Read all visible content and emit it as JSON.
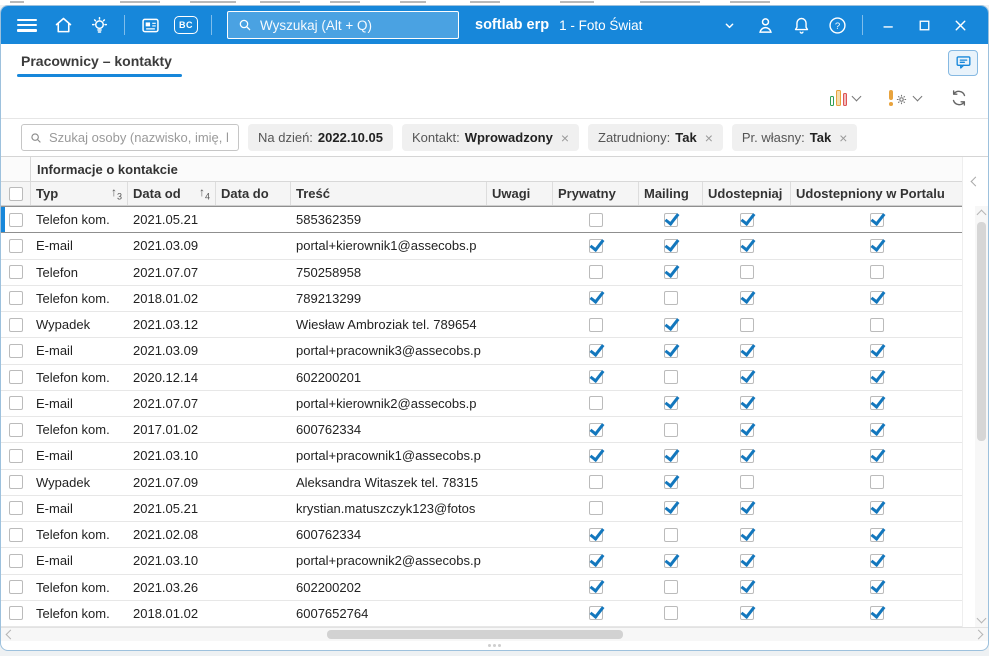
{
  "topbar": {
    "search_placeholder": "Wyszukaj (Alt + Q)",
    "app_name": "softlab erp",
    "company_selector": "1 - Foto Świat",
    "bc_badge": "BC"
  },
  "page": {
    "title": "Pracownicy – kontakty"
  },
  "filters": {
    "person_search_placeholder": "Szukaj osoby (nazwisko, imię, l",
    "chips": [
      {
        "label": "Na dzień:",
        "value": "2022.10.05",
        "closable": false
      },
      {
        "label": "Kontakt:",
        "value": "Wprowadzony",
        "closable": true
      },
      {
        "label": "Zatrudniony:",
        "value": "Tak",
        "closable": true
      },
      {
        "label": "Pr. własny:",
        "value": "Tak",
        "closable": true
      }
    ]
  },
  "table": {
    "group_header": "Informacje o kontakcie",
    "columns": {
      "typ": "Typ",
      "typ_sort": "3",
      "data_od": "Data od",
      "data_od_sort": "4",
      "data_do": "Data do",
      "tresc": "Treść",
      "uwagi": "Uwagi",
      "prywatny": "Prywatny",
      "mailing": "Mailing",
      "udostepniaj": "Udostepniaj",
      "portal": "Udostepniony w Portalu"
    },
    "rows": [
      {
        "typ": "Telefon kom.",
        "data_od": "2021.05.21",
        "data_do": "",
        "tresc": "585362359",
        "uwagi": "",
        "prywatny": false,
        "mailing": true,
        "udostepniaj": true,
        "portal": true,
        "selected": true
      },
      {
        "typ": "E-mail",
        "data_od": "2021.03.09",
        "data_do": "",
        "tresc": "portal+kierownik1@assecobs.p",
        "uwagi": "",
        "prywatny": true,
        "mailing": true,
        "udostepniaj": true,
        "portal": true
      },
      {
        "typ": "Telefon",
        "data_od": "2021.07.07",
        "data_do": "",
        "tresc": "750258958",
        "uwagi": "",
        "prywatny": false,
        "mailing": true,
        "udostepniaj": false,
        "portal": false
      },
      {
        "typ": "Telefon kom.",
        "data_od": "2018.01.02",
        "data_do": "",
        "tresc": "789213299",
        "uwagi": "",
        "prywatny": true,
        "mailing": false,
        "udostepniaj": true,
        "portal": true
      },
      {
        "typ": "Wypadek",
        "data_od": "2021.03.12",
        "data_do": "",
        "tresc": "Wiesław Ambroziak tel. 789654",
        "uwagi": "",
        "prywatny": false,
        "mailing": true,
        "udostepniaj": false,
        "portal": false
      },
      {
        "typ": "E-mail",
        "data_od": "2021.03.09",
        "data_do": "",
        "tresc": "portal+pracownik3@assecobs.p",
        "uwagi": "",
        "prywatny": true,
        "mailing": true,
        "udostepniaj": true,
        "portal": true
      },
      {
        "typ": "Telefon kom.",
        "data_od": "2020.12.14",
        "data_do": "",
        "tresc": "602200201",
        "uwagi": "",
        "prywatny": true,
        "mailing": false,
        "udostepniaj": true,
        "portal": true
      },
      {
        "typ": "E-mail",
        "data_od": "2021.07.07",
        "data_do": "",
        "tresc": "portal+kierownik2@assecobs.p",
        "uwagi": "",
        "prywatny": false,
        "mailing": true,
        "udostepniaj": true,
        "portal": true
      },
      {
        "typ": "Telefon kom.",
        "data_od": "2017.01.02",
        "data_do": "",
        "tresc": "600762334",
        "uwagi": "",
        "prywatny": true,
        "mailing": false,
        "udostepniaj": true,
        "portal": true
      },
      {
        "typ": "E-mail",
        "data_od": "2021.03.10",
        "data_do": "",
        "tresc": "portal+pracownik1@assecobs.p",
        "uwagi": "",
        "prywatny": true,
        "mailing": true,
        "udostepniaj": true,
        "portal": true
      },
      {
        "typ": "Wypadek",
        "data_od": "2021.07.09",
        "data_do": "",
        "tresc": "Aleksandra Witaszek tel. 78315",
        "uwagi": "",
        "prywatny": false,
        "mailing": true,
        "udostepniaj": false,
        "portal": false
      },
      {
        "typ": "E-mail",
        "data_od": "2021.05.21",
        "data_do": "",
        "tresc": "krystian.matuszczyk123@fotos",
        "uwagi": "",
        "prywatny": false,
        "mailing": true,
        "udostepniaj": true,
        "portal": true
      },
      {
        "typ": "Telefon kom.",
        "data_od": "2021.02.08",
        "data_do": "",
        "tresc": "600762334",
        "uwagi": "",
        "prywatny": true,
        "mailing": false,
        "udostepniaj": true,
        "portal": true
      },
      {
        "typ": "E-mail",
        "data_od": "2021.03.10",
        "data_do": "",
        "tresc": "portal+pracownik2@assecobs.p",
        "uwagi": "",
        "prywatny": true,
        "mailing": true,
        "udostepniaj": true,
        "portal": true
      },
      {
        "typ": "Telefon kom.",
        "data_od": "2021.03.26",
        "data_do": "",
        "tresc": "602200202",
        "uwagi": "",
        "prywatny": true,
        "mailing": false,
        "udostepniaj": true,
        "portal": true
      },
      {
        "typ": "Telefon kom.",
        "data_od": "2018.01.02",
        "data_do": "",
        "tresc": "6007652764",
        "uwagi": "",
        "prywatny": true,
        "mailing": false,
        "udostepniaj": true,
        "portal": true
      }
    ]
  },
  "colors": {
    "accent": "#1787da",
    "check": "#1377bd"
  }
}
